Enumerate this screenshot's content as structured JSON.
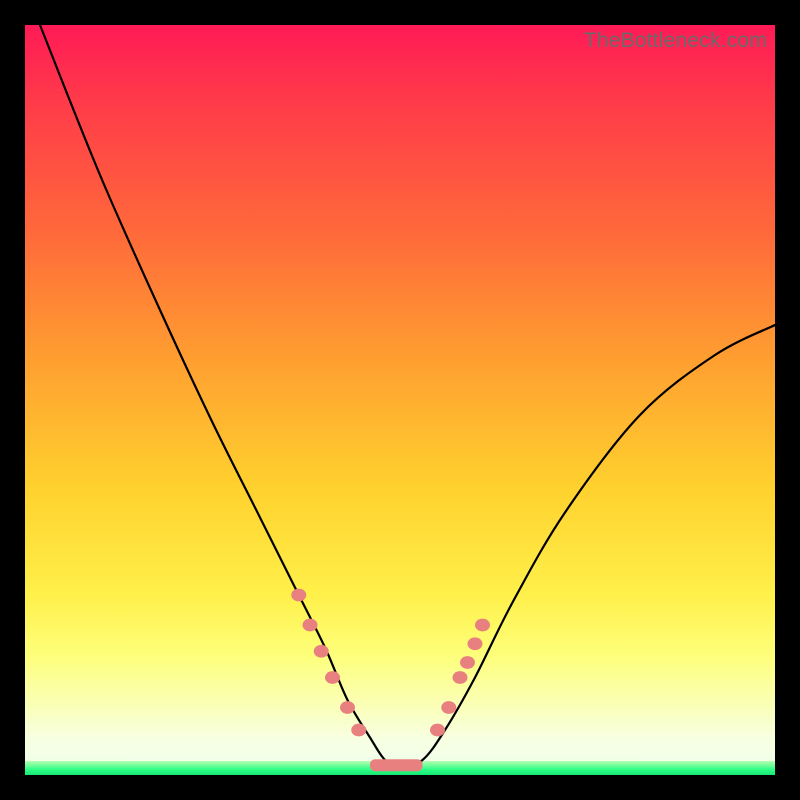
{
  "watermark": "TheBottleneck.com",
  "colors": {
    "background_frame": "#000000",
    "gradient_top": "#ff1a56",
    "gradient_mid": "#ffd22e",
    "gradient_bottom": "#eeffee",
    "green_strip": "#15e873",
    "curve": "#000000",
    "marker": "#e98080"
  },
  "chart_data": {
    "type": "line",
    "title": "",
    "xlabel": "",
    "ylabel": "",
    "xlim": [
      0,
      100
    ],
    "ylim": [
      0,
      100
    ],
    "series": [
      {
        "name": "curve",
        "x": [
          2,
          10,
          18,
          25,
          31,
          36,
          40,
          43,
          46,
          48,
          50,
          53,
          56,
          60,
          65,
          72,
          82,
          92,
          100
        ],
        "y": [
          100,
          80,
          62,
          47,
          35,
          25,
          17,
          10,
          5,
          2,
          1,
          2,
          6,
          13,
          23,
          35,
          48,
          56,
          60
        ]
      }
    ],
    "markers_left": [
      [
        36.5,
        24
      ],
      [
        38,
        20
      ],
      [
        39.5,
        16.5
      ],
      [
        41,
        13
      ],
      [
        43,
        9
      ],
      [
        44.5,
        6
      ]
    ],
    "markers_right": [
      [
        55,
        6
      ],
      [
        56.5,
        9
      ],
      [
        58,
        13
      ],
      [
        59,
        15
      ],
      [
        60,
        17.5
      ],
      [
        61,
        20
      ]
    ],
    "flat_segment": {
      "x0": 46,
      "x1": 53,
      "y": 1.3
    }
  }
}
